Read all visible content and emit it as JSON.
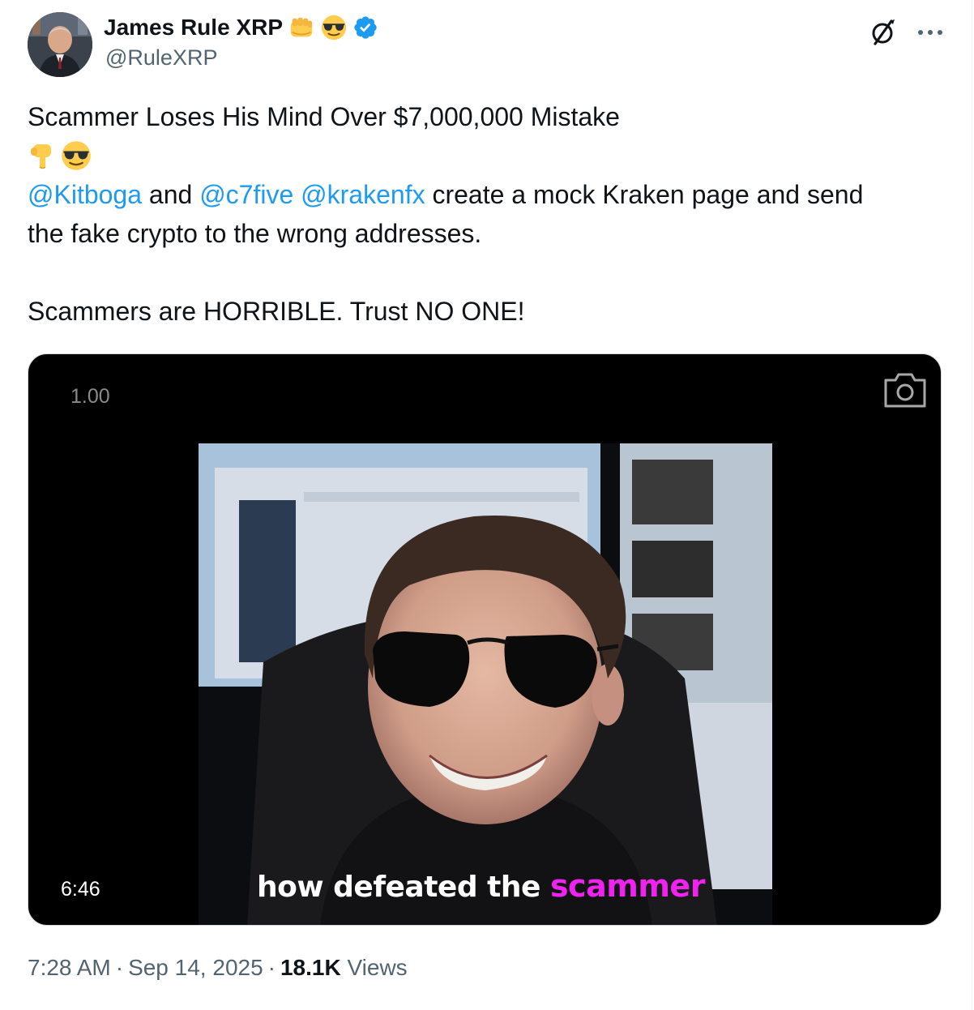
{
  "author": {
    "name": "James Rule XRP",
    "handle": "@RuleXRP",
    "badges": [
      "fist-emoji",
      "sunglasses-emoji",
      "verified-badge"
    ],
    "verified_color": "#1d9bf0"
  },
  "tweet": {
    "line1": "Scammer Loses His Mind Over $7,000,000 Mistake",
    "emoji_line": [
      "backhand-index-pointing-down-emoji",
      "sunglasses-emoji"
    ],
    "mentions": {
      "kitboga": "@Kitboga",
      "c7five": "@c7five",
      "krakenfx": "@krakenfx"
    },
    "connector_and": " and ",
    "line3_rest": " create a mock Kraken page and send",
    "line4": "the fake crypto to the wrong addresses.",
    "line6": "Scammers are HORRIBLE. Trust NO ONE!"
  },
  "media": {
    "playback_speed": "1.00",
    "duration": "6:46",
    "caption_main": "how defeated the ",
    "caption_highlight": "scammer",
    "caption_highlight_color": "#f022f0"
  },
  "meta": {
    "time": "7:28 AM",
    "date": "Sep 14, 2025",
    "separator": "·",
    "views_count": "18.1K",
    "views_label": "Views"
  },
  "colors": {
    "link": "#1d9bf0",
    "secondary_text": "#536471",
    "primary_text": "#0f1419"
  }
}
